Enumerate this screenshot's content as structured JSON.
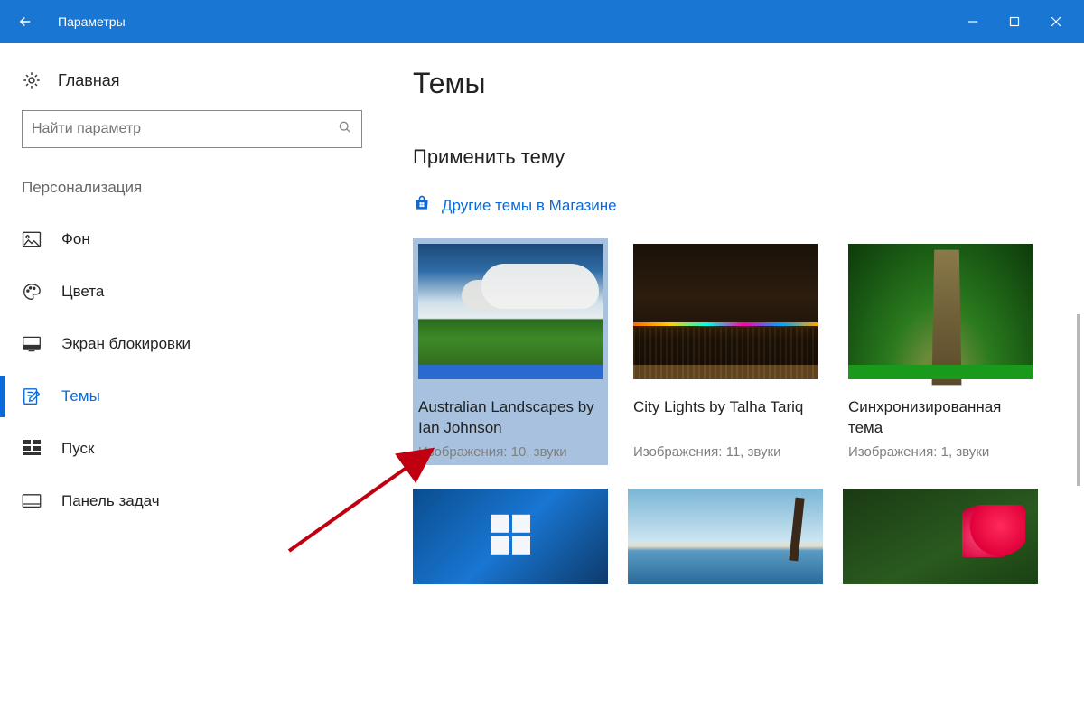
{
  "window": {
    "title": "Параметры"
  },
  "sidebar": {
    "home": "Главная",
    "search_placeholder": "Найти параметр",
    "group": "Персонализация",
    "items": [
      {
        "label": "Фон"
      },
      {
        "label": "Цвета"
      },
      {
        "label": "Экран блокировки"
      },
      {
        "label": "Темы"
      },
      {
        "label": "Пуск"
      },
      {
        "label": "Панель задач"
      }
    ]
  },
  "main": {
    "title": "Темы",
    "section": "Применить тему",
    "store_link": "Другие темы в Магазине",
    "themes": [
      {
        "name": "Australian Landscapes by Ian Johnson",
        "meta": "Изображения: 10, звуки",
        "accent": "#2a6ad0",
        "selected": true
      },
      {
        "name": "City Lights by Talha Tariq",
        "meta": "Изображения: 11, звуки",
        "accent": "#c29048",
        "selected": false
      },
      {
        "name": "Синхронизированная тема",
        "meta": "Изображения: 1, звуки",
        "accent": "#1a9a1a",
        "selected": false
      }
    ]
  }
}
